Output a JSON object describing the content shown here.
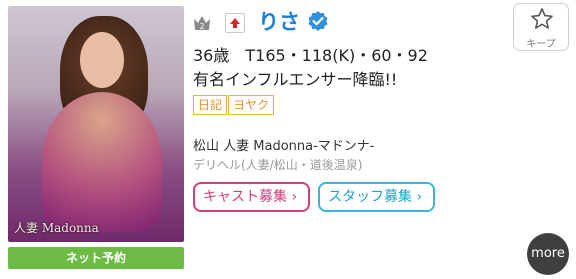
{
  "profile": {
    "name": "りさ",
    "spec": "36歳　T165・118(K)・60・92",
    "catch_copy": "有名インフルエンサー降臨!!",
    "tags": [
      "日記",
      "ヨヤク"
    ],
    "shop": "松山 人妻 Madonna-マドンナ-",
    "category": "デリヘル(人妻/松山・道後温泉)",
    "photo_logo": "人妻 Madonna",
    "rank_number": "2"
  },
  "actions": {
    "reserve_label": "ネット予約",
    "cast_recruit_label": "キャスト募集",
    "staff_recruit_label": "スタッフ募集",
    "keep_label": "キープ",
    "more_label": "more"
  },
  "icons": {
    "rank": "crown-icon",
    "badge": "up-arrow-icon",
    "verified": "verified-check-icon",
    "keep": "star-icon"
  },
  "colors": {
    "name": "#1b7fd6",
    "reserve_bg": "#6dbb45",
    "tag": "#efb14a",
    "cast_pill": "#d43e7f",
    "staff_pill": "#38b7dd",
    "more_bg": "#3f3f3f"
  }
}
